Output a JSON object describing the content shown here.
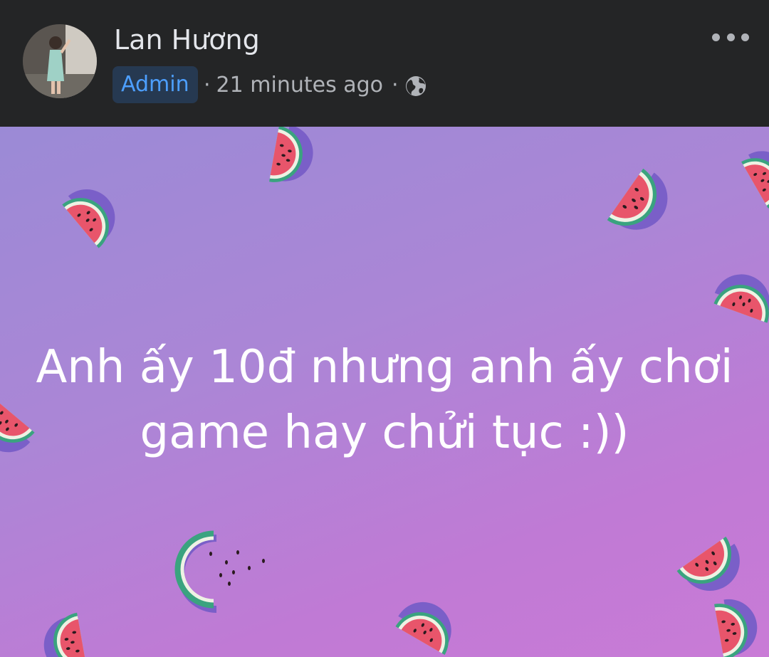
{
  "post_header": {
    "author_name": "Lan Hương",
    "role_badge": "Admin",
    "separator": "·",
    "timestamp": "21 minutes ago",
    "audience_icon": "globe-icon",
    "more_icon": "more-horizontal-icon"
  },
  "post": {
    "background_theme": "purple-watermelon",
    "text": "Anh ấy 10đ nhưng anh ấy chơi game hay chửi tục :))"
  },
  "colors": {
    "header_bg": "#242526",
    "badge_bg": "#263951",
    "badge_text": "#4d9fff",
    "text_secondary": "#b0b3b8",
    "post_bg_start": "#9b8ad6",
    "post_bg_end": "#c97bd6"
  }
}
